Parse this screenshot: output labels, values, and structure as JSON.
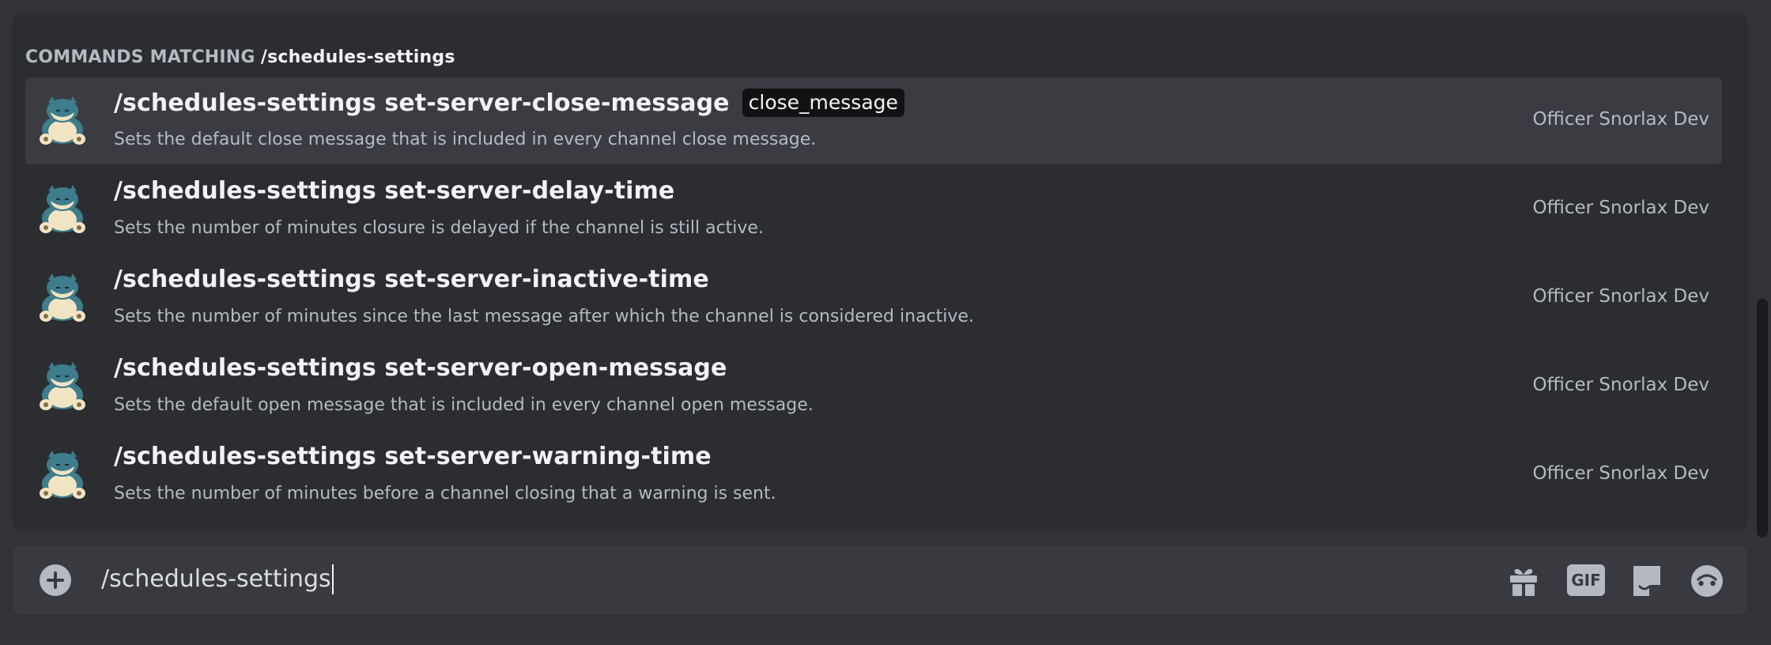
{
  "autocomplete": {
    "header_label": "COMMANDS MATCHING",
    "header_query": "/schedules-settings",
    "commands": [
      {
        "name": "/schedules-settings set-server-close-message",
        "param": "close_message",
        "description": "Sets the default close message that is included in every channel close message.",
        "source": "Officer Snorlax Dev",
        "selected": true
      },
      {
        "name": "/schedules-settings set-server-delay-time",
        "param": "",
        "description": "Sets the number of minutes closure is delayed if the channel is still active.",
        "source": "Officer Snorlax Dev",
        "selected": false
      },
      {
        "name": "/schedules-settings set-server-inactive-time",
        "param": "",
        "description": "Sets the number of minutes since the last message after which the channel is considered inactive.",
        "source": "Officer Snorlax Dev",
        "selected": false
      },
      {
        "name": "/schedules-settings set-server-open-message",
        "param": "",
        "description": "Sets the default open message that is included in every channel open message.",
        "source": "Officer Snorlax Dev",
        "selected": false
      },
      {
        "name": "/schedules-settings set-server-warning-time",
        "param": "",
        "description": "Sets the number of minutes before a channel closing that a warning is sent.",
        "source": "Officer Snorlax Dev",
        "selected": false
      }
    ]
  },
  "composer": {
    "value": "/schedules-settings",
    "gif_label": "GIF",
    "icons": [
      "add-icon",
      "gift-icon",
      "gif-icon",
      "sticker-icon",
      "emoji-icon"
    ]
  },
  "colors": {
    "background": "#313338",
    "popup": "#2b2d31",
    "selected_row": "#3a3c42",
    "composer": "#383a40",
    "param_chip": "#111214"
  }
}
